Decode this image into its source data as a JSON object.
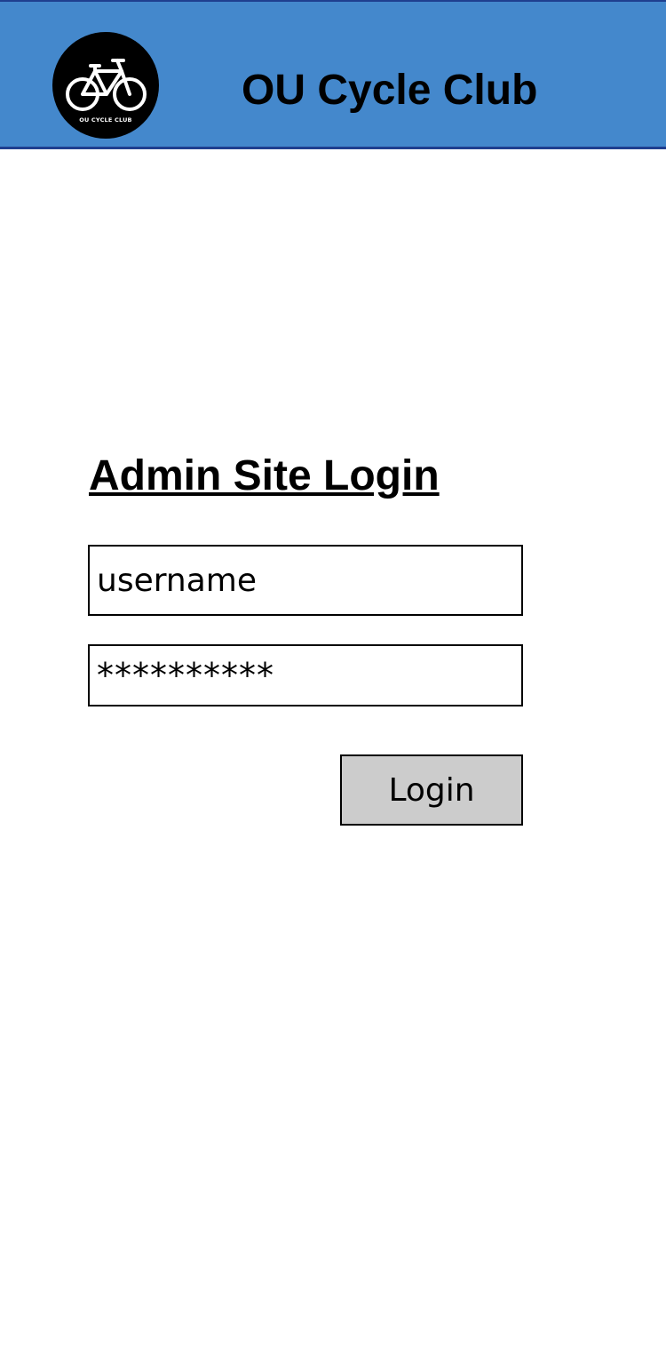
{
  "header": {
    "logo_text": "OU CYCLE CLUB",
    "title": "OU Cycle Club",
    "background_color": "#4488cc"
  },
  "login": {
    "heading": "Admin Site Login",
    "username_value": "username",
    "password_value": "**********",
    "button_label": "Login",
    "button_color": "#cccccc"
  }
}
